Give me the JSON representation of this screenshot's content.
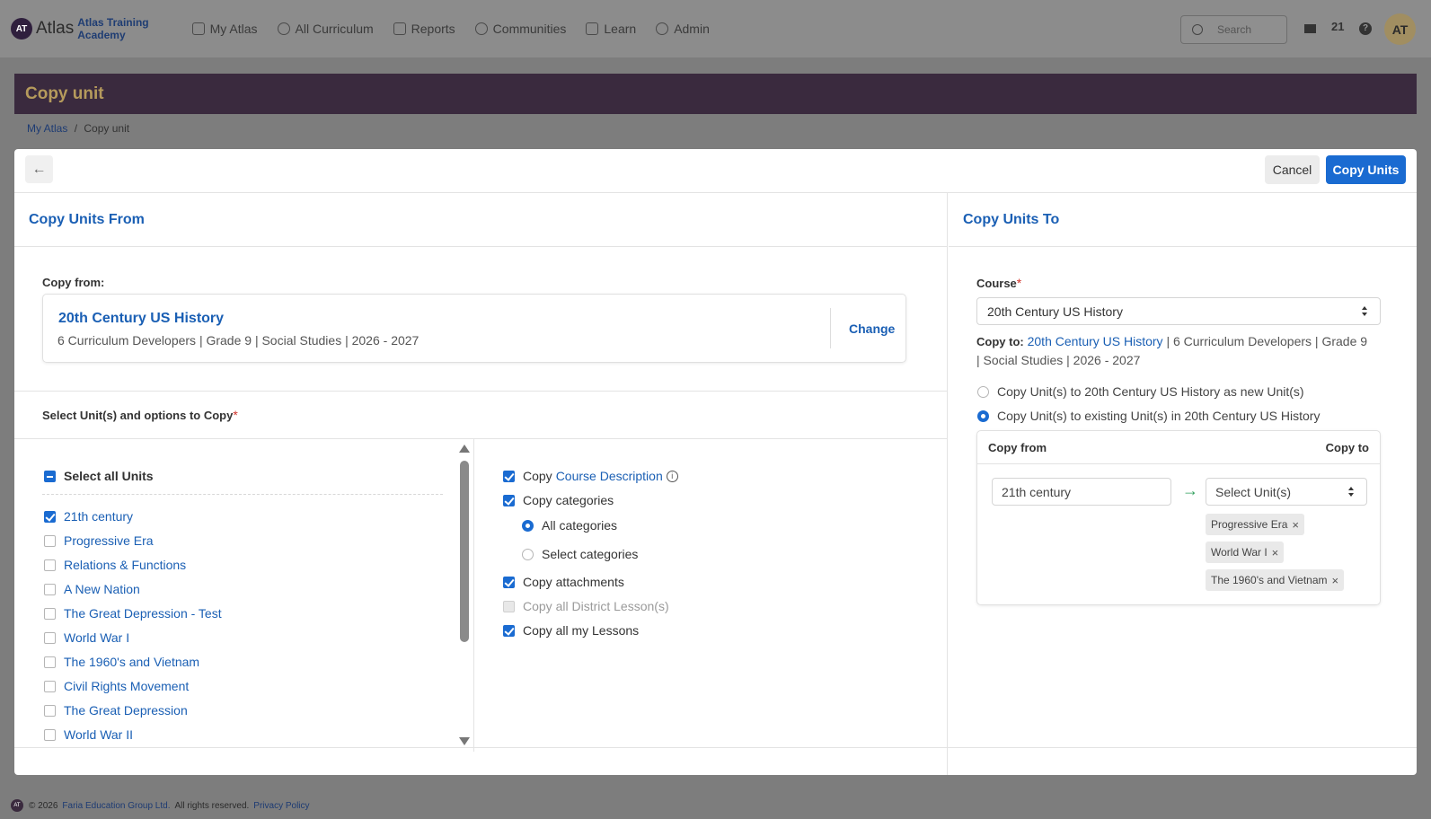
{
  "app": {
    "logo_badge": "AT",
    "logo_name": "Atlas",
    "logo_sub_line1": "Atlas Training",
    "logo_sub_line2": "Academy"
  },
  "nav": {
    "items": [
      {
        "label": "My Atlas",
        "icon": "home-icon"
      },
      {
        "label": "All Curriculum",
        "icon": "globe-icon"
      },
      {
        "label": "Reports",
        "icon": "chart-icon"
      },
      {
        "label": "Communities",
        "icon": "network-icon"
      },
      {
        "label": "Learn",
        "icon": "book-icon"
      },
      {
        "label": "Admin",
        "icon": "gear-icon"
      }
    ],
    "search_placeholder": "Search",
    "notification_count": "21",
    "help": "?",
    "avatar_initials": "AT"
  },
  "page": {
    "title": "Copy unit",
    "breadcrumb": {
      "root": "My Atlas",
      "separator": "/",
      "current": "Copy unit"
    }
  },
  "toolbar": {
    "back": "←",
    "cancel": "Cancel",
    "copy_units": "Copy Units"
  },
  "copy_from": {
    "section_title": "Copy Units From",
    "label": "Copy from:",
    "course_name": "20th Century US History",
    "course_meta": "6 Curriculum Developers | Grade 9 | Social Studies | 2026 - 2027",
    "change": "Change",
    "select_label": "Select Unit(s) and options to Copy",
    "required_mark": "*",
    "select_all": "Select all Units",
    "units": [
      {
        "name": "21th century",
        "checked": true
      },
      {
        "name": "Progressive Era",
        "checked": false
      },
      {
        "name": "Relations & Functions",
        "checked": false
      },
      {
        "name": "A New Nation",
        "checked": false
      },
      {
        "name": "The Great Depression - Test",
        "checked": false
      },
      {
        "name": "World War I",
        "checked": false
      },
      {
        "name": "The 1960's and Vietnam",
        "checked": false
      },
      {
        "name": "Civil Rights Movement",
        "checked": false
      },
      {
        "name": "The Great Depression",
        "checked": false
      },
      {
        "name": "World War II",
        "checked": false
      }
    ],
    "options": {
      "copy_prefix": "Copy",
      "course_description": "Course Description",
      "info": "i",
      "copy_categories": "Copy categories",
      "all_categories": "All categories",
      "select_categories": "Select categories",
      "copy_attachments": "Copy attachments",
      "copy_district_lessons": "Copy all District Lesson(s)",
      "copy_my_lessons": "Copy all my Lessons"
    }
  },
  "copy_to": {
    "section_title": "Copy Units To",
    "course_label": "Course",
    "required_mark": "*",
    "course_selected": "20th Century US History",
    "copy_to_label": "Copy to:",
    "copy_to_course": "20th Century US History",
    "copy_to_meta_line1": " | 6 Curriculum Developers | Grade 9",
    "copy_to_meta_line2": "| Social Studies | 2026 - 2027",
    "radio_new": "Copy Unit(s) to 20th Century US History as new Unit(s)",
    "radio_existing": "Copy Unit(s) to existing Unit(s) in 20th Century US History",
    "map_head_from": "Copy from",
    "map_head_to": "Copy to",
    "map_source": "21th century",
    "map_arrow": "→",
    "map_select_placeholder": "Select Unit(s)",
    "tags": [
      "Progressive Era",
      "World War I",
      "The 1960's and Vietnam"
    ],
    "tag_remove": "×"
  },
  "footer": {
    "badge": "AT",
    "copyright": "© 2026",
    "company": "Faria Education Group Ltd.",
    "rights": "All rights reserved.",
    "privacy": "Privacy Policy"
  },
  "colors": {
    "primary": "#1a6bd1",
    "link": "#1a5fb4",
    "header_bg": "#3a2a3e",
    "title_gold": "#b59a5c",
    "overlay": "#7d7d7d"
  }
}
